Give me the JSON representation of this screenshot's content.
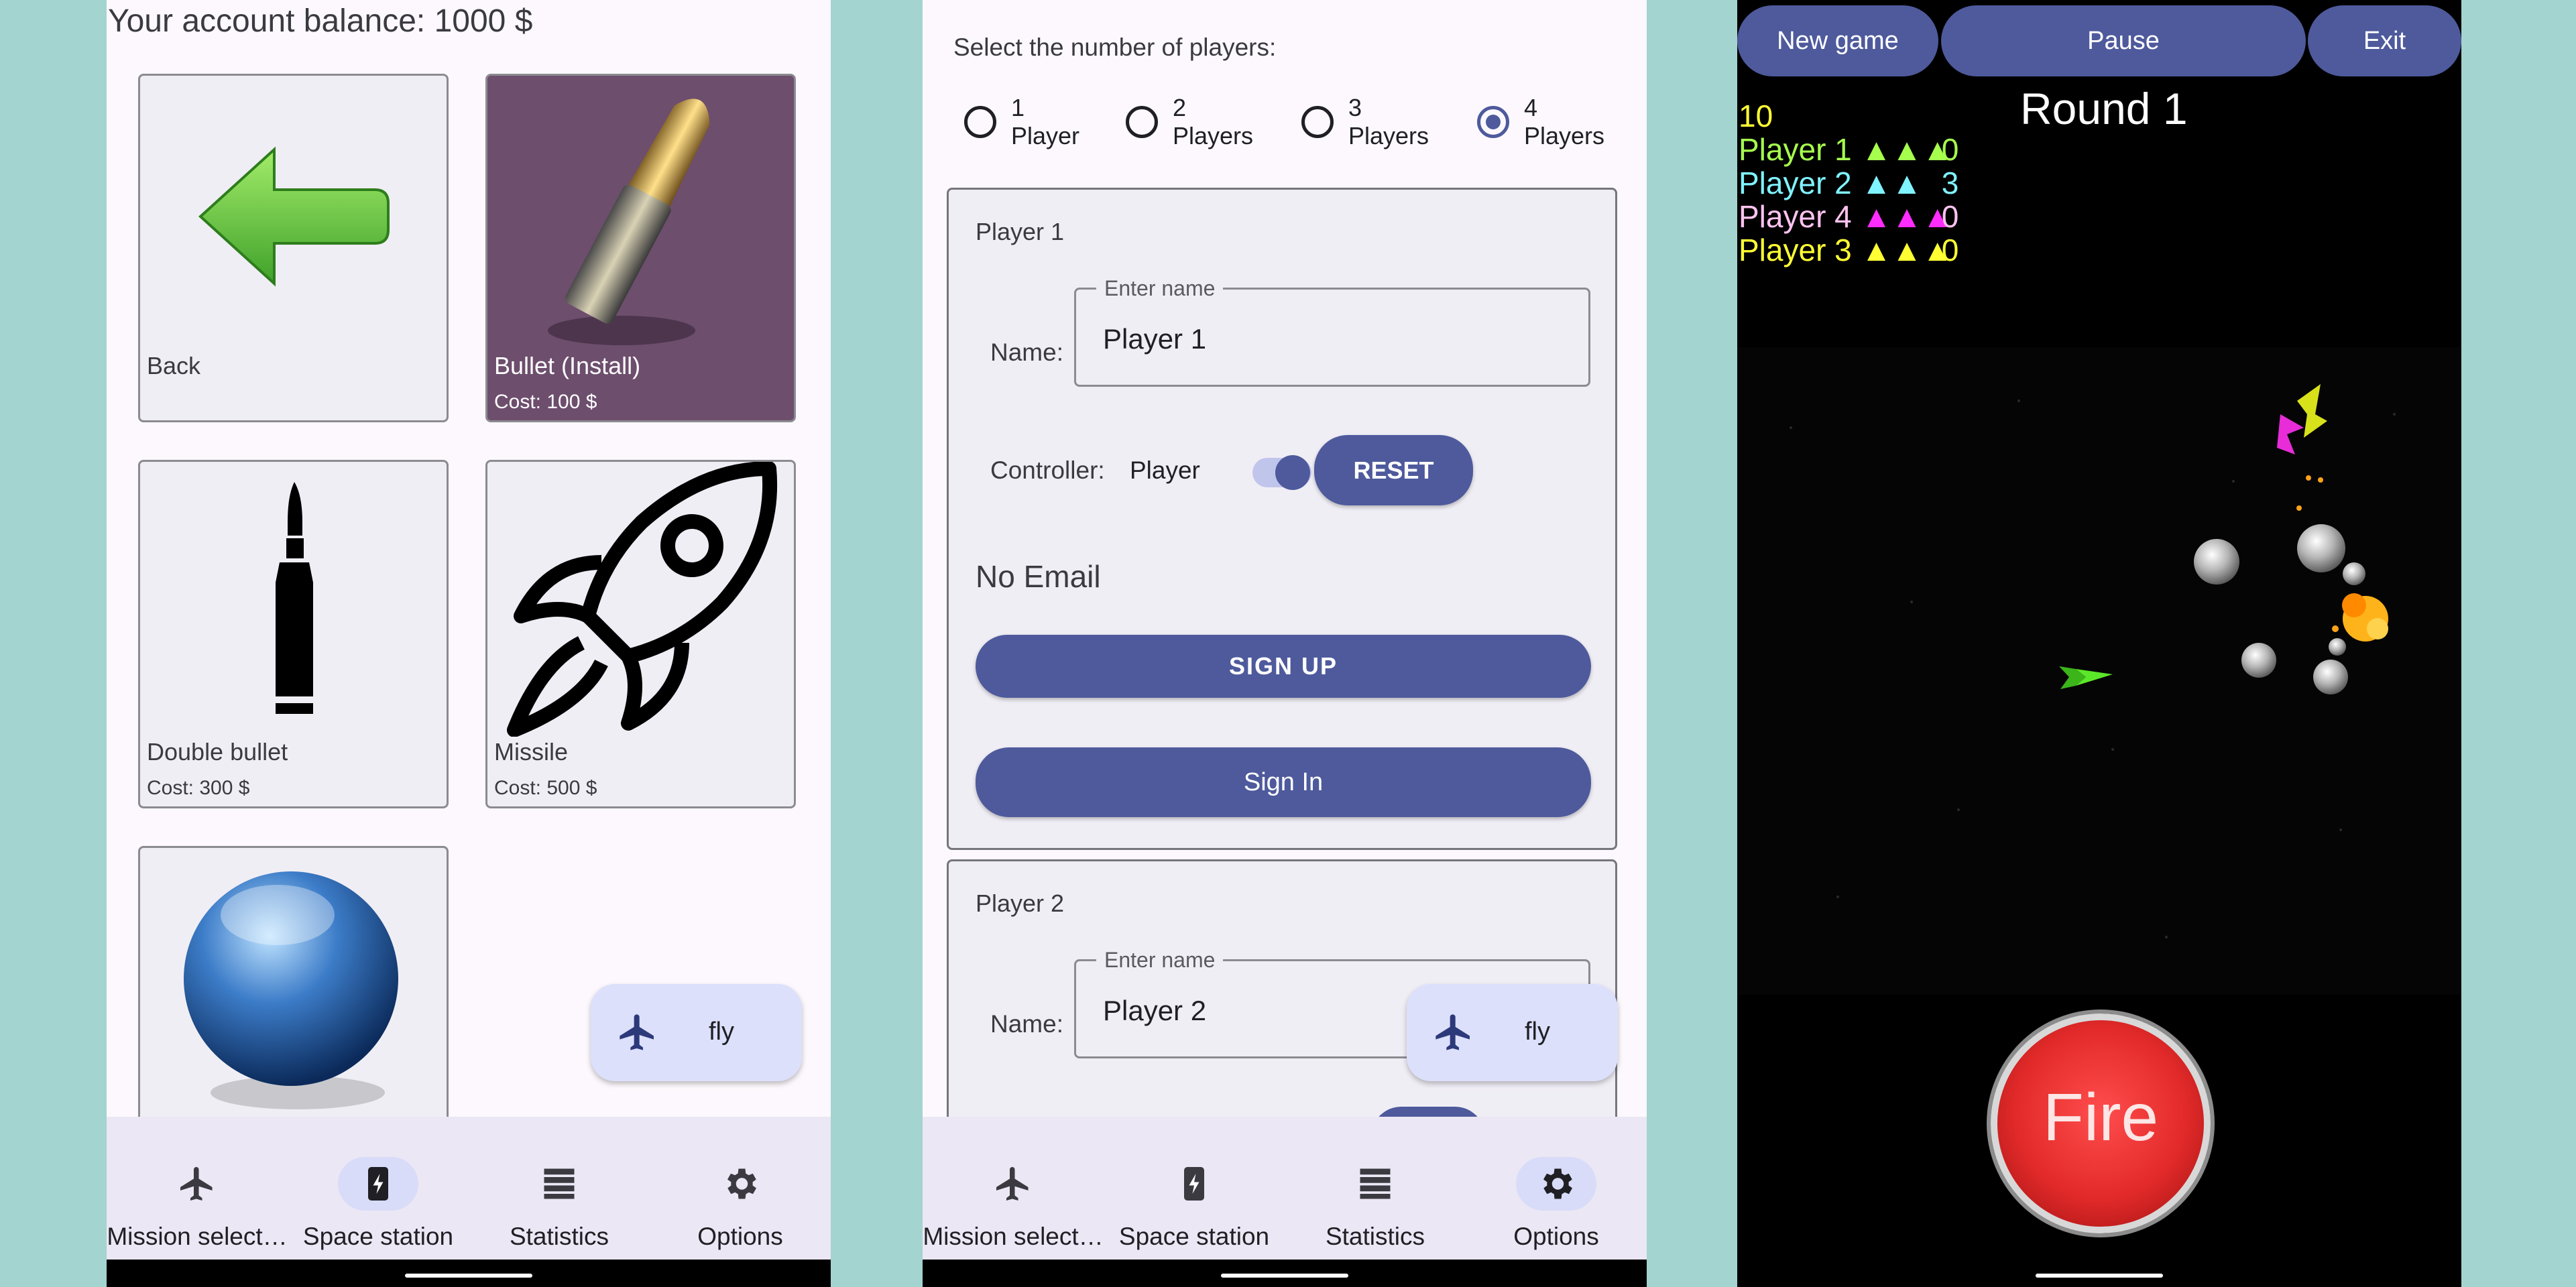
{
  "nav": {
    "items": [
      {
        "label": "Mission select…",
        "icon": "airplane-icon"
      },
      {
        "label": "Space station",
        "icon": "phone-charging-icon"
      },
      {
        "label": "Statistics",
        "icon": "list-bars-icon"
      },
      {
        "label": "Options",
        "icon": "gear-icon"
      }
    ]
  },
  "shop": {
    "balance": "Your account balance: 1000 $",
    "cards": [
      {
        "name": "Back",
        "cost": "",
        "icon": "arrow-left-icon"
      },
      {
        "name": "Bullet (Install)",
        "cost": "Cost: 100 $",
        "icon": "bullet-icon",
        "selected": true
      },
      {
        "name": "Double bullet",
        "cost": "Cost: 300 $",
        "icon": "double-bullet-icon"
      },
      {
        "name": "Missile",
        "cost": "Cost: 500 $",
        "icon": "rocket-icon"
      },
      {
        "name": "",
        "cost": "",
        "icon": "sphere-shield-icon"
      }
    ],
    "fab": {
      "label": "fly",
      "icon": "airplane-icon"
    }
  },
  "options": {
    "hint": "Select the number of players:",
    "radios": [
      {
        "label": "1\nPlayer",
        "checked": false
      },
      {
        "label": "2\nPlayers",
        "checked": false
      },
      {
        "label": "3\nPlayers",
        "checked": false
      },
      {
        "label": "4\nPlayers",
        "checked": true
      }
    ],
    "player1": {
      "title": "Player 1",
      "name_label": "Name:",
      "name_legend": "Enter name",
      "name_value": "Player 1",
      "controller_label": "Controller:",
      "controller_value": "Player",
      "reset": "RESET",
      "email": "No Email",
      "signup": "SIGN UP",
      "signin": "Sign In"
    },
    "player2": {
      "title": "Player 2",
      "name_label": "Name:",
      "name_legend": "Enter name",
      "name_value": "Player 2"
    },
    "fab": {
      "label": "fly",
      "icon": "airplane-icon"
    }
  },
  "game": {
    "buttons": {
      "new_game": "New game",
      "pause": "Pause",
      "exit": "Exit"
    },
    "round": "Round 1",
    "counter": "10",
    "players": [
      {
        "name": "Player 1",
        "lives": 3,
        "score": "0",
        "color": "#a6ff4d"
      },
      {
        "name": "Player 2",
        "lives": 2,
        "score": "3",
        "color": "#7ff3ff"
      },
      {
        "name": "Player 4",
        "lives": 3,
        "score": "0",
        "color": "#ffc3f0",
        "life_color": "#ff2cff"
      },
      {
        "name": "Player 3",
        "lives": 3,
        "score": "0",
        "color": "#ffff33"
      }
    ],
    "fire": "Fire"
  },
  "colors": {
    "primary": "#4e5a9c",
    "nav_bg": "#ebe7f4",
    "fab_bg": "#dde0fb",
    "fire_red": "#e32a2a"
  }
}
